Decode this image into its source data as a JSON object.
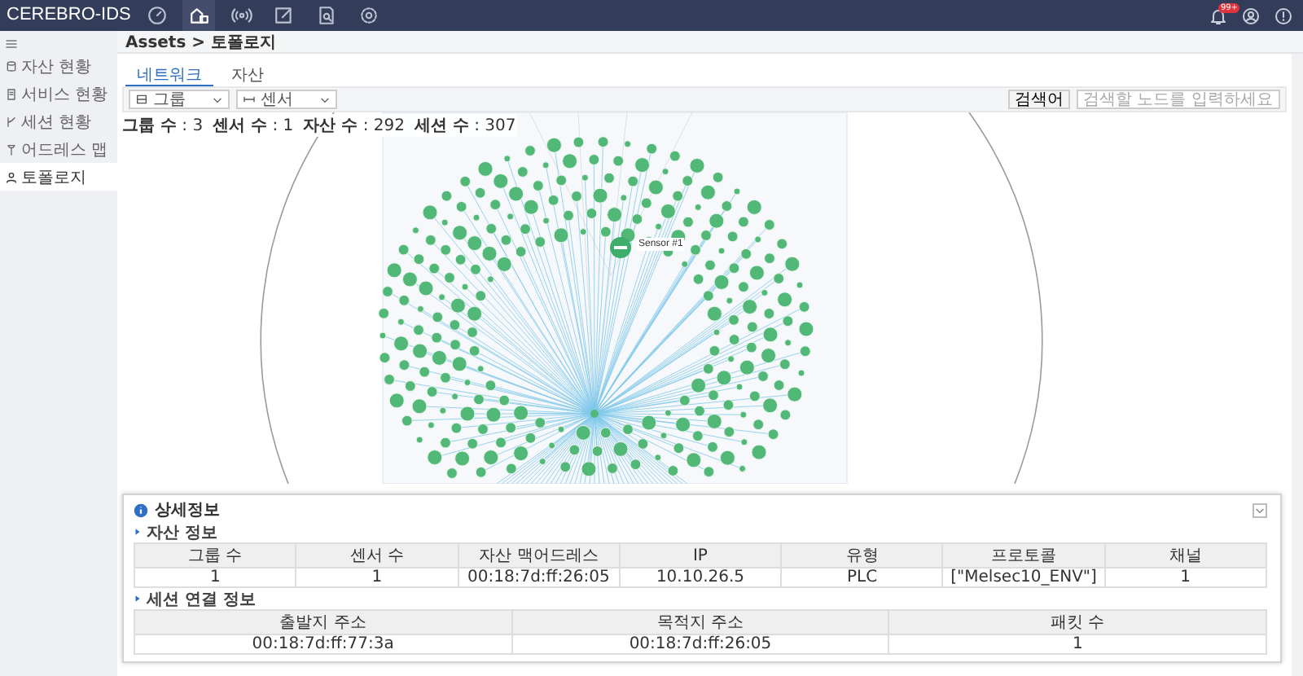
{
  "app": {
    "title": "CEREBRO-IDS",
    "nav": [
      {
        "kind": "gauge",
        "selected": false
      },
      {
        "kind": "assets",
        "selected": true
      },
      {
        "kind": "signal",
        "selected": false
      },
      {
        "kind": "edit",
        "selected": false
      },
      {
        "kind": "report",
        "selected": false
      },
      {
        "kind": "settings",
        "selected": false
      }
    ],
    "notification_badge": "99+"
  },
  "sidebar": {
    "items": [
      {
        "kind": "database",
        "label": "자산 현황",
        "selected": false
      },
      {
        "kind": "server",
        "label": "서비스 현황",
        "selected": false
      },
      {
        "kind": "branch",
        "label": "세션 현황",
        "selected": false
      },
      {
        "kind": "map",
        "label": "어드레스 맵",
        "selected": false
      },
      {
        "kind": "topology",
        "label": "토폴로지",
        "selected": true
      }
    ]
  },
  "breadcrumb": "Assets > 토폴로지",
  "tabs": [
    {
      "label": "네트워크",
      "selected": true
    },
    {
      "label": "자산",
      "selected": false
    }
  ],
  "filters": [
    {
      "kind": "group",
      "value": "그룹"
    },
    {
      "kind": "sensor",
      "value": "센서"
    }
  ],
  "search": {
    "button": "검색어",
    "placeholder": "검색할 노드를 입력하세요"
  },
  "stats": [
    {
      "label": "그룹 수",
      "value": ": 3"
    },
    {
      "label": "센서 수",
      "value": ": 1"
    },
    {
      "label": "자산 수",
      "value": ": 292"
    },
    {
      "label": "세션 수",
      "value": ": 307"
    }
  ],
  "graph": {
    "sensor_label": "Sensor #1"
  },
  "details": {
    "title": "상세정보",
    "asset_info": {
      "title": "자산 정보",
      "columns": [
        "그룹 수",
        "센서 수",
        "자산 맥어드레스",
        "IP",
        "유형",
        "프로토콜",
        "채널"
      ],
      "rows": [
        [
          "1",
          "1",
          "00:18:7d:ff:26:05",
          "10.10.26.5",
          "PLC",
          "[\"Melsec10_ENV\"]",
          "1"
        ]
      ]
    },
    "session_info": {
      "title": "세션 연결 정보",
      "columns": [
        "출발지 주소",
        "목적지 주소",
        "패킷 수"
      ],
      "rows": [
        [
          "00:18:7d:ff:77:3a",
          "00:18:7d:ff:26:05",
          "1"
        ]
      ]
    }
  }
}
